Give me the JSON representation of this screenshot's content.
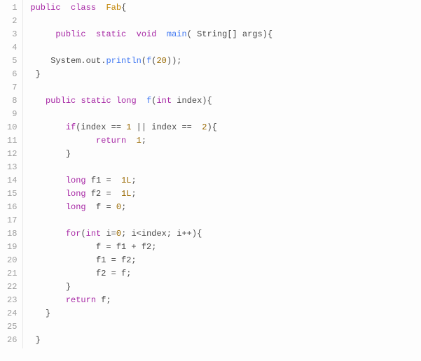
{
  "language": "java",
  "line_count": 26,
  "tokens": [
    [
      {
        "t": "public",
        "c": "kw"
      },
      {
        "t": "  ",
        "c": ""
      },
      {
        "t": "class",
        "c": "kw"
      },
      {
        "t": "  ",
        "c": ""
      },
      {
        "t": "Fab",
        "c": "cls"
      },
      {
        "t": "{",
        "c": ""
      }
    ],
    [],
    [
      {
        "t": "     ",
        "c": ""
      },
      {
        "t": "public",
        "c": "kw"
      },
      {
        "t": "  ",
        "c": ""
      },
      {
        "t": "static",
        "c": "kw"
      },
      {
        "t": "  ",
        "c": ""
      },
      {
        "t": "void",
        "c": "kw"
      },
      {
        "t": "  ",
        "c": ""
      },
      {
        "t": "main",
        "c": "fn"
      },
      {
        "t": "( String[] args){",
        "c": ""
      }
    ],
    [],
    [
      {
        "t": "    System.out.",
        "c": ""
      },
      {
        "t": "println",
        "c": "fn"
      },
      {
        "t": "(",
        "c": ""
      },
      {
        "t": "f",
        "c": "fn"
      },
      {
        "t": "(",
        "c": ""
      },
      {
        "t": "20",
        "c": "num"
      },
      {
        "t": "));",
        "c": ""
      }
    ],
    [
      {
        "t": " }",
        "c": ""
      }
    ],
    [],
    [
      {
        "t": "   ",
        "c": ""
      },
      {
        "t": "public",
        "c": "kw"
      },
      {
        "t": " ",
        "c": ""
      },
      {
        "t": "static",
        "c": "kw"
      },
      {
        "t": " ",
        "c": ""
      },
      {
        "t": "long",
        "c": "kw"
      },
      {
        "t": "  ",
        "c": ""
      },
      {
        "t": "f",
        "c": "fn"
      },
      {
        "t": "(",
        "c": ""
      },
      {
        "t": "int",
        "c": "kw"
      },
      {
        "t": " index){",
        "c": ""
      }
    ],
    [],
    [
      {
        "t": "       ",
        "c": ""
      },
      {
        "t": "if",
        "c": "kw"
      },
      {
        "t": "(index == ",
        "c": ""
      },
      {
        "t": "1",
        "c": "num"
      },
      {
        "t": " || index ==  ",
        "c": ""
      },
      {
        "t": "2",
        "c": "num"
      },
      {
        "t": "){",
        "c": ""
      }
    ],
    [
      {
        "t": "             ",
        "c": ""
      },
      {
        "t": "return",
        "c": "kw"
      },
      {
        "t": "  ",
        "c": ""
      },
      {
        "t": "1",
        "c": "num"
      },
      {
        "t": ";",
        "c": ""
      }
    ],
    [
      {
        "t": "       }",
        "c": ""
      }
    ],
    [],
    [
      {
        "t": "       ",
        "c": ""
      },
      {
        "t": "long",
        "c": "kw"
      },
      {
        "t": " f1 =  ",
        "c": ""
      },
      {
        "t": "1L",
        "c": "num"
      },
      {
        "t": ";",
        "c": ""
      }
    ],
    [
      {
        "t": "       ",
        "c": ""
      },
      {
        "t": "long",
        "c": "kw"
      },
      {
        "t": " f2 =  ",
        "c": ""
      },
      {
        "t": "1L",
        "c": "num"
      },
      {
        "t": ";",
        "c": ""
      }
    ],
    [
      {
        "t": "       ",
        "c": ""
      },
      {
        "t": "long",
        "c": "kw"
      },
      {
        "t": "  f = ",
        "c": ""
      },
      {
        "t": "0",
        "c": "num"
      },
      {
        "t": ";",
        "c": ""
      }
    ],
    [],
    [
      {
        "t": "       ",
        "c": ""
      },
      {
        "t": "for",
        "c": "kw"
      },
      {
        "t": "(",
        "c": ""
      },
      {
        "t": "int",
        "c": "kw"
      },
      {
        "t": " i=",
        "c": ""
      },
      {
        "t": "0",
        "c": "num"
      },
      {
        "t": "; i<index; i++){",
        "c": ""
      }
    ],
    [
      {
        "t": "             f = f1 + f2;",
        "c": ""
      }
    ],
    [
      {
        "t": "             f1 = f2;",
        "c": ""
      }
    ],
    [
      {
        "t": "             f2 = f;",
        "c": ""
      }
    ],
    [
      {
        "t": "       }",
        "c": ""
      }
    ],
    [
      {
        "t": "       ",
        "c": ""
      },
      {
        "t": "return",
        "c": "kw"
      },
      {
        "t": " f;",
        "c": ""
      }
    ],
    [
      {
        "t": "   }",
        "c": ""
      }
    ],
    [],
    [
      {
        "t": " }",
        "c": ""
      }
    ]
  ]
}
